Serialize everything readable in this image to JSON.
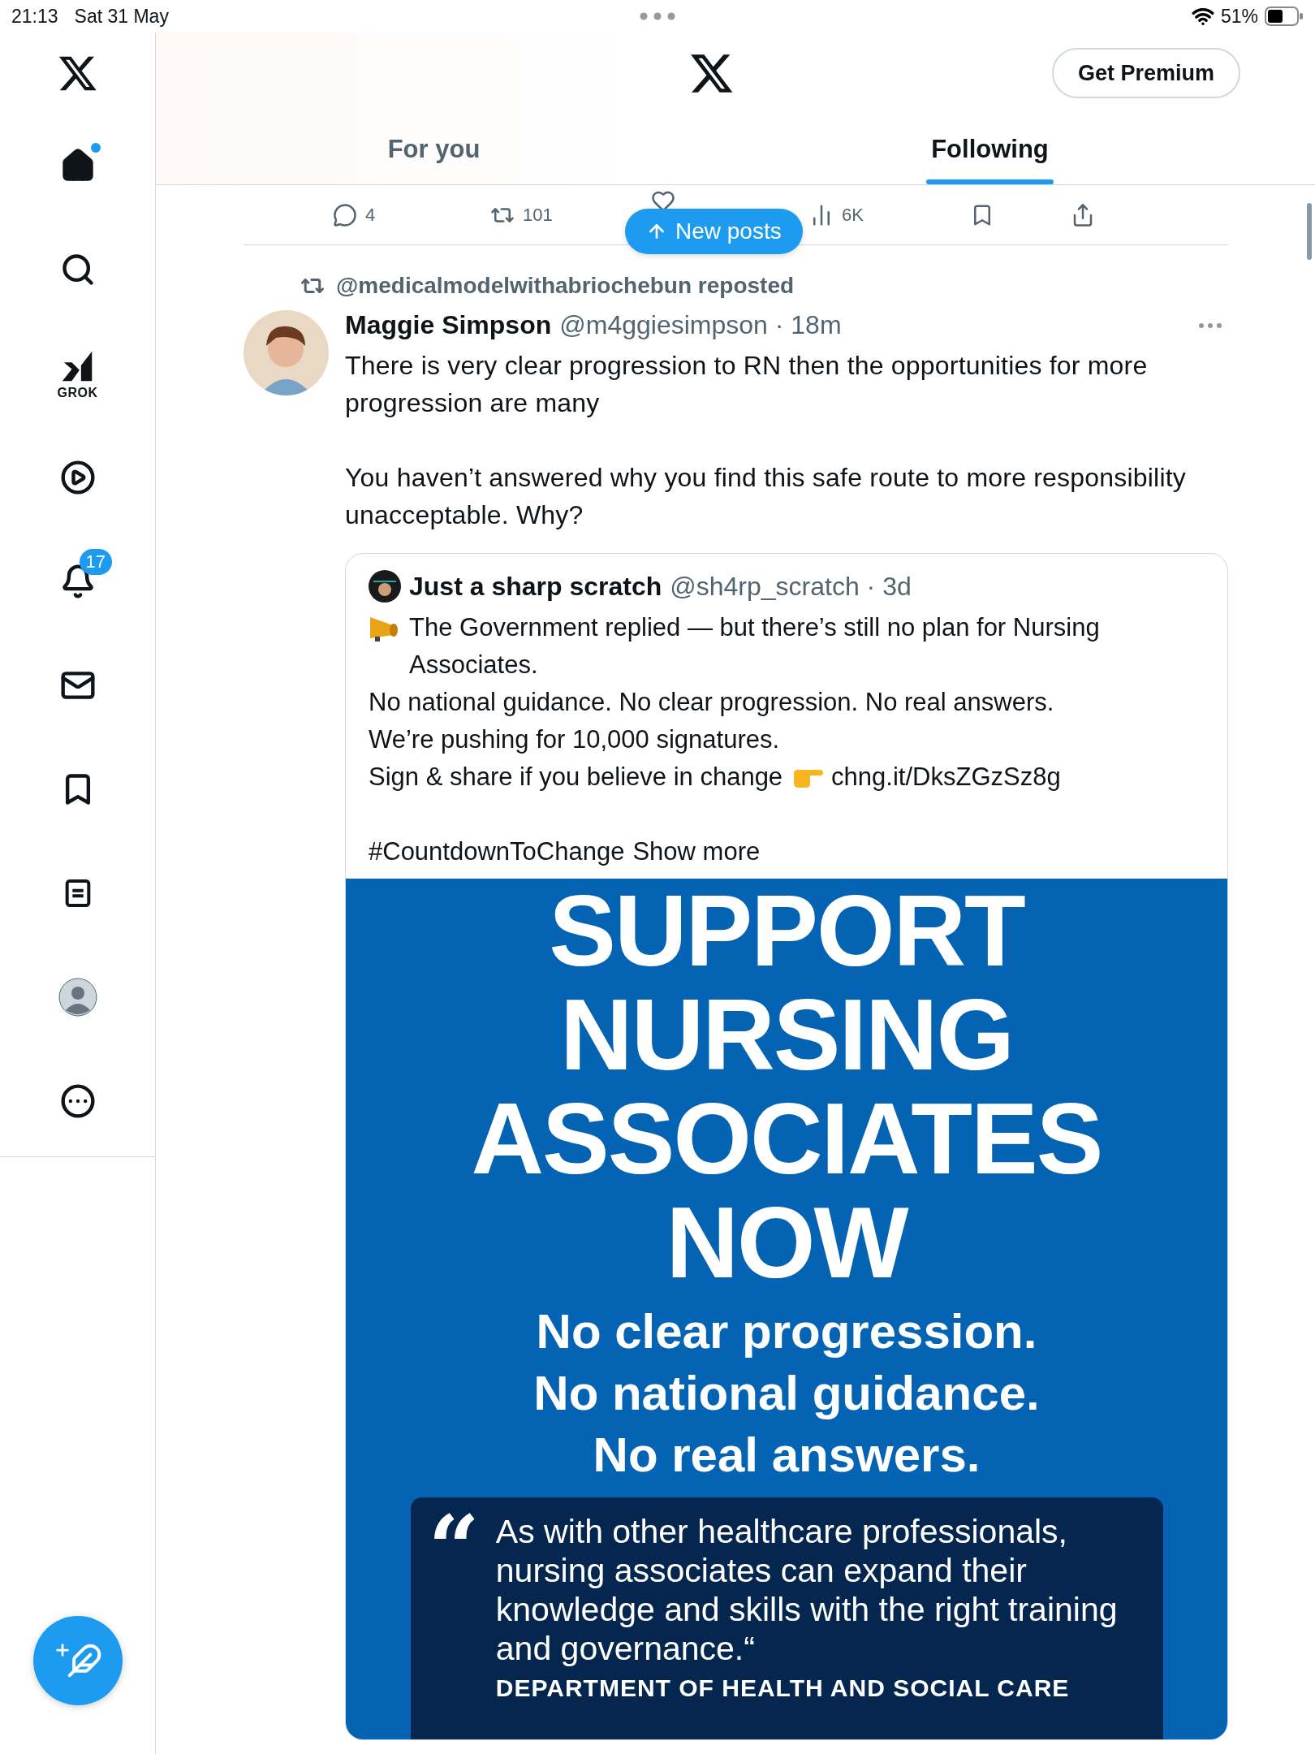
{
  "status_bar": {
    "time": "21:13",
    "date": "Sat 31 May",
    "battery": "51%"
  },
  "sidebar": {
    "items": [
      {
        "kind": "home",
        "notify_dot": true
      },
      {
        "kind": "search",
        "notify_dot": false
      },
      {
        "kind": "grok",
        "label": "GROK",
        "notify_dot": false
      },
      {
        "kind": "video",
        "notify_dot": false
      },
      {
        "kind": "notifications",
        "badge": "17",
        "notify_dot": false
      },
      {
        "kind": "messages",
        "notify_dot": false
      },
      {
        "kind": "bookmarks",
        "notify_dot": false
      },
      {
        "kind": "lists",
        "notify_dot": false
      },
      {
        "kind": "profile",
        "notify_dot": false
      },
      {
        "kind": "more",
        "notify_dot": false
      }
    ]
  },
  "header": {
    "premium_button": "Get Premium"
  },
  "tabs": [
    {
      "label": "For you",
      "selected": false
    },
    {
      "label": "Following",
      "selected": true
    }
  ],
  "action_bar": [
    {
      "kind": "reply",
      "count": "4"
    },
    {
      "kind": "repost",
      "count": "101"
    },
    {
      "kind": "like"
    },
    {
      "kind": "views",
      "count": "6K"
    },
    {
      "kind": "bookmark"
    },
    {
      "kind": "share"
    }
  ],
  "new_posts_button": "New posts",
  "post": {
    "repost_line": "@medicalmodelwithabriochebun reposted",
    "author": "Maggie Simpson",
    "meta": "@m4ggiesimpson · 18m",
    "paragraphs": [
      "There is very clear progression to RN then the opportunities for more progression are many",
      "You haven’t answered why you find this safe route to more responsibility unacceptable. Why?"
    ],
    "quote": {
      "author": "Just a sharp scratch",
      "meta": "@sh4rp_scratch · 3d",
      "lines": [
        {
          "kind": "megaphone",
          "text": "The Government replied — but there’s still no plan for Nursing Associates."
        },
        {
          "kind": "plain",
          "text": "No national guidance. No clear progression. No real answers."
        },
        {
          "kind": "plain",
          "text": "We’re pushing for 10,000 signatures."
        },
        {
          "kind": "link",
          "text": "Sign & share if you believe in change",
          "link": "chng.it/DksZGzSz8g"
        }
      ],
      "hashtag": "#CountdownToChange",
      "show_more": "Show more",
      "poster": {
        "headline": [
          "SUPPORT",
          "NURSING",
          "ASSOCIATES",
          "NOW"
        ],
        "subtitle": [
          "No clear progression.",
          "No national guidance.",
          "No real answers."
        ],
        "quote_mark": "“",
        "quote": "As with other healthcare professionals, nursing associates can expand their knowledge and skills with the right training and governance.“",
        "source": "DEPARTMENT OF HEALTH AND SOCIAL CARE"
      }
    }
  }
}
